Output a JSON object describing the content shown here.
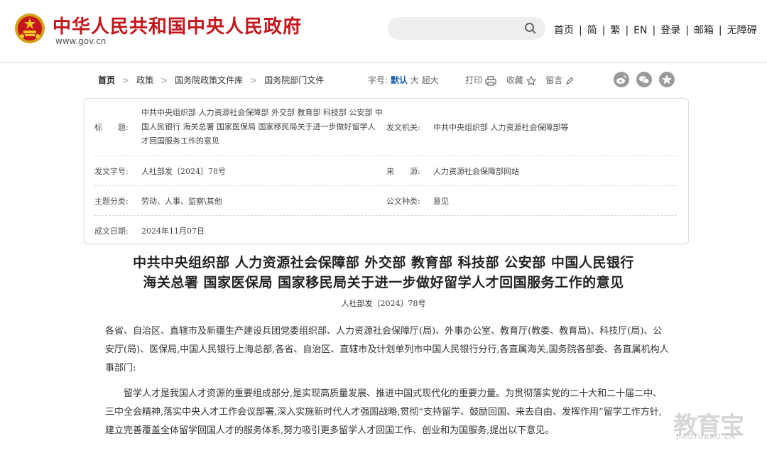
{
  "header": {
    "site_name": "中华人民共和国中央人民政府",
    "site_url": "www.gov.cn",
    "search_placeholder": "",
    "nav": [
      "首页",
      "简",
      "繁",
      "EN",
      "登录",
      "邮箱",
      "无障碍"
    ]
  },
  "breadcrumb": [
    "首页",
    "政策",
    "国务院政策文件库",
    "国务院部门文件"
  ],
  "tools": {
    "font_size_label": "字号:",
    "font_sizes": [
      "默认",
      "大",
      "超大"
    ],
    "active_font_size": "默认",
    "print": "打印",
    "favorite": "收藏",
    "comment": "留言"
  },
  "share_icons": [
    "weibo-icon",
    "wechat-icon",
    "favorite-star-icon"
  ],
  "info": {
    "title_label": "标　　题:",
    "title_value": "中共中央组织部 人力资源社会保障部 外交部 教育部 科技部 公安部 中国人民银行 海关总署 国家医保局 国家移民局关于进一步做好留学人才回国服务工作的意见",
    "issuer_label": "发文机关:",
    "issuer_value": "中共中央组织部 人力资源社会保障部等",
    "number_label": "发文字号:",
    "number_value": "人社部发〔2024〕78号",
    "source_label": "来　　源:",
    "source_value": "人力资源社会保障部网站",
    "topic_label": "主题分类:",
    "topic_value": "劳动、人事、监察\\其他",
    "type_label": "公文种类:",
    "type_value": "意见",
    "date_label": "成文日期:",
    "date_value": "2024年11月07日"
  },
  "article": {
    "title_line1": "中共中央组织部 人力资源社会保障部 外交部 教育部 科技部 公安部 中国人民银行",
    "title_line2": "海关总署 国家医保局 国家移民局关于进一步做好留学人才回国服务工作的意见",
    "doc_number": "人社部发〔2024〕78号",
    "para1": "各省、自治区、直辖市及新疆生产建设兵团党委组织部、人力资源社会保障厅(局)、外事办公室、教育厅(教委、教育局)、科技厅(局)、公安厅(局)、医保局,中国人民银行上海总部,各省、自治区、直辖市及计划单列市中国人民银行分行,各直属海关,国务院各部委、各直属机构人事部门:",
    "para2": "留学人才是我国人才资源的重要组成部分,是实现高质量发展、推进中国式现代化的重要力量。为贯彻落实党的二十大和二十届二中、三中全会精神,落实中央人才工作会议部署,深入实施新时代人才强国战略,贯彻“支持留学、鼓励回国、来去自由、发挥作用”留学工作方针,建立完善覆盖全体留学回国人才的服务体系,努力吸引更多留学人才回国工作、创业和为国服务,提出以下意见。"
  },
  "watermark": {
    "text": "教育宝",
    "url": "JIAOYUBAO.CN"
  },
  "colors": {
    "brand_red": "#c4161c",
    "link_blue": "#1a5fa8"
  }
}
